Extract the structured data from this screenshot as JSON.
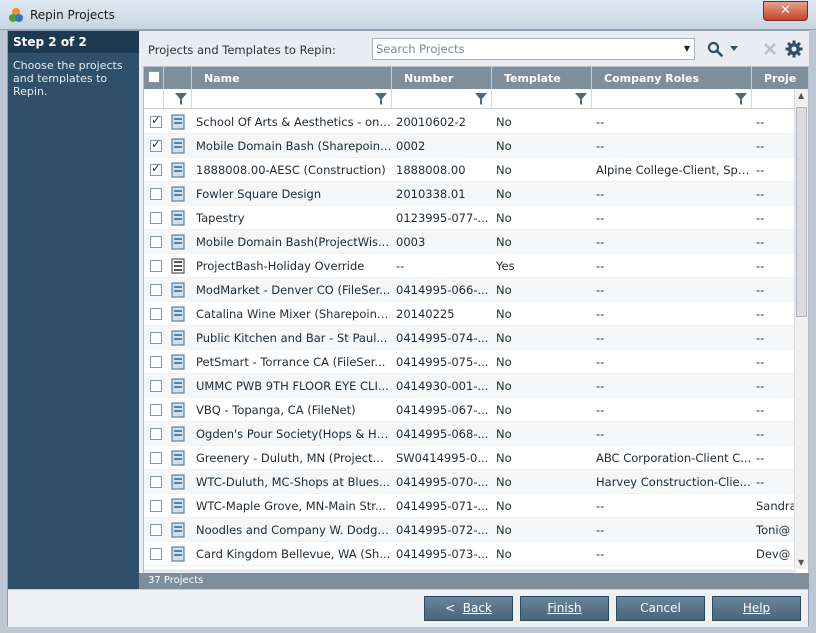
{
  "window": {
    "title": "Repin Projects",
    "close_label": "✕"
  },
  "steps": {
    "title": "Step 2 of 2",
    "description": "Choose the projects and templates to Repin."
  },
  "toolbar": {
    "label": "Projects and Templates to Repin:",
    "search_placeholder": "Search Projects"
  },
  "columns": [
    "Name",
    "Number",
    "Template",
    "Company Roles",
    "Proje"
  ],
  "rows": [
    {
      "checked": true,
      "icon": "project-icon",
      "name": "School Of Arts & Aesthetics - onl...",
      "number": "20010602-2",
      "template": "No",
      "roles": "--",
      "proj": "--"
    },
    {
      "checked": true,
      "icon": "project-icon",
      "name": "Mobile Domain Bash (Sharepoint...",
      "number": "0002",
      "template": "No",
      "roles": "--",
      "proj": "--"
    },
    {
      "checked": true,
      "icon": "project-icon",
      "name": "1888008.00-AESC (Construction)",
      "number": "1888008.00",
      "template": "No",
      "roles": "Alpine College-Client, Spr...",
      "proj": "--"
    },
    {
      "checked": false,
      "icon": "project-icon",
      "name": "Fowler Square Design",
      "number": "2010338.01",
      "template": "No",
      "roles": "--",
      "proj": "--"
    },
    {
      "checked": false,
      "icon": "project-icon",
      "name": "Tapestry",
      "number": "0123995-077-...",
      "template": "No",
      "roles": "--",
      "proj": "--"
    },
    {
      "checked": false,
      "icon": "project-icon",
      "name": "Mobile Domain Bash(ProjectWis...",
      "number": "0003",
      "template": "No",
      "roles": "--",
      "proj": "--"
    },
    {
      "checked": false,
      "icon": "template-icon",
      "name": "ProjectBash-Holiday Override",
      "number": "--",
      "template": "Yes",
      "roles": "--",
      "proj": "--"
    },
    {
      "checked": false,
      "icon": "project-icon",
      "name": "ModMarket - Denver CO (FileSer...",
      "number": "0414995-066-...",
      "template": "No",
      "roles": "--",
      "proj": "--"
    },
    {
      "checked": false,
      "icon": "project-icon",
      "name": "Catalina Wine Mixer (Sharepoint...",
      "number": "20140225",
      "template": "No",
      "roles": "--",
      "proj": "--"
    },
    {
      "checked": false,
      "icon": "project-icon",
      "name": "Public Kitchen and Bar - St Paul...",
      "number": "0414995-074-...",
      "template": "No",
      "roles": "--",
      "proj": "--"
    },
    {
      "checked": false,
      "icon": "project-icon",
      "name": "PetSmart - Torrance CA (FileSer...",
      "number": "0414995-075-...",
      "template": "No",
      "roles": "--",
      "proj": "--"
    },
    {
      "checked": false,
      "icon": "project-icon",
      "name": "UMMC PWB 9TH FLOOR EYE CLI...",
      "number": "0414930-001-...",
      "template": "No",
      "roles": "--",
      "proj": "--"
    },
    {
      "checked": false,
      "icon": "project-icon",
      "name": "VBQ - Topanga, CA (FileNet)",
      "number": "0414995-067-...",
      "template": "No",
      "roles": "--",
      "proj": "--"
    },
    {
      "checked": false,
      "icon": "project-icon",
      "name": "Ogden's Pour Society(Hops & Ha...",
      "number": "0414995-068-...",
      "template": "No",
      "roles": "--",
      "proj": "--"
    },
    {
      "checked": false,
      "icon": "project-icon",
      "name": "Greenery - Duluth, MN (Project...",
      "number": "SW0414995-0...",
      "template": "No",
      "roles": "ABC Corporation-Client C...",
      "proj": "--"
    },
    {
      "checked": false,
      "icon": "project-icon",
      "name": "WTC-Duluth, MC-Shops at Blues...",
      "number": "0414995-070-...",
      "template": "No",
      "roles": "Harvey Construction-Clie...",
      "proj": "--"
    },
    {
      "checked": false,
      "icon": "project-icon",
      "name": "WTC-Maple Grove, MN-Main Str...",
      "number": "0414995-071-...",
      "template": "No",
      "roles": "--",
      "proj": "Sandra"
    },
    {
      "checked": false,
      "icon": "project-icon",
      "name": "Noodles and Company W. Dodge...",
      "number": "0414995-072-...",
      "template": "No",
      "roles": "--",
      "proj": "Toni@"
    },
    {
      "checked": false,
      "icon": "project-icon",
      "name": "Card Kingdom Bellevue, WA (Sh...",
      "number": "0414995-073-...",
      "template": "No",
      "roles": "--",
      "proj": "Dev@"
    }
  ],
  "status": "37 Projects",
  "footer": {
    "back_arrow": "<",
    "back_label": "Back",
    "finish_label": "Finish",
    "cancel_label": "Cancel",
    "help_label": "Help"
  },
  "colors": {
    "header": "#7f8e9b",
    "sidebar": "#2f5068",
    "button": "#46657c"
  }
}
